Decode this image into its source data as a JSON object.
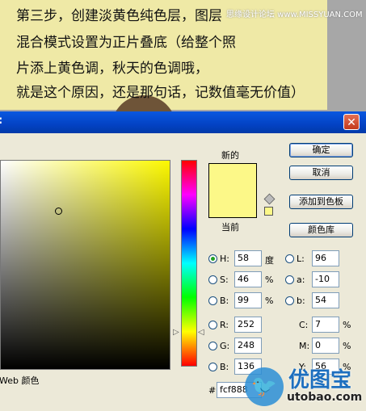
{
  "tutorial": {
    "lines": [
      "第三步，创建淡黄色纯色层，图层",
      "混合模式设置为正片叠底（给整个照",
      "片添上黄色调，秋天的色调哦，",
      "就是这个原因，还是那句话，记数值毫无价值）"
    ],
    "watermark_top": "思缘设计论坛 www.MISSYUAN.COM"
  },
  "dialog": {
    "title": ":",
    "close_glyph": "✕",
    "new_label": "新的",
    "current_label": "当前",
    "web_colors_label": "Web 颜色",
    "colors": {
      "new": "#fcf888",
      "current": "#fcf888"
    },
    "buttons": {
      "ok": "确定",
      "cancel": "取消",
      "add_swatch": "添加到色板",
      "libraries": "颜色库"
    },
    "hsb": {
      "h": {
        "label": "H:",
        "value": "58",
        "unit": "度"
      },
      "s": {
        "label": "S:",
        "value": "46",
        "unit": "%"
      },
      "b": {
        "label": "B:",
        "value": "99",
        "unit": "%"
      }
    },
    "rgb": {
      "r": {
        "label": "R:",
        "value": "252"
      },
      "g": {
        "label": "G:",
        "value": "248"
      },
      "b": {
        "label": "B:",
        "value": "136"
      }
    },
    "lab": {
      "l": {
        "label": "L:",
        "value": "96"
      },
      "a": {
        "label": "a:",
        "value": "-10"
      },
      "b": {
        "label": "b:",
        "value": "54"
      }
    },
    "cmyk": {
      "c": {
        "label": "C:",
        "value": "7",
        "unit": "%"
      },
      "m": {
        "label": "M:",
        "value": "0",
        "unit": "%"
      },
      "y": {
        "label": "Y:",
        "value": "56",
        "unit": "%"
      }
    },
    "hex": {
      "prefix": "#",
      "value": "fcf888"
    }
  },
  "site_watermark": {
    "name": "优图宝",
    "url": "utobao.com",
    "logo_glyph": "🐦"
  }
}
